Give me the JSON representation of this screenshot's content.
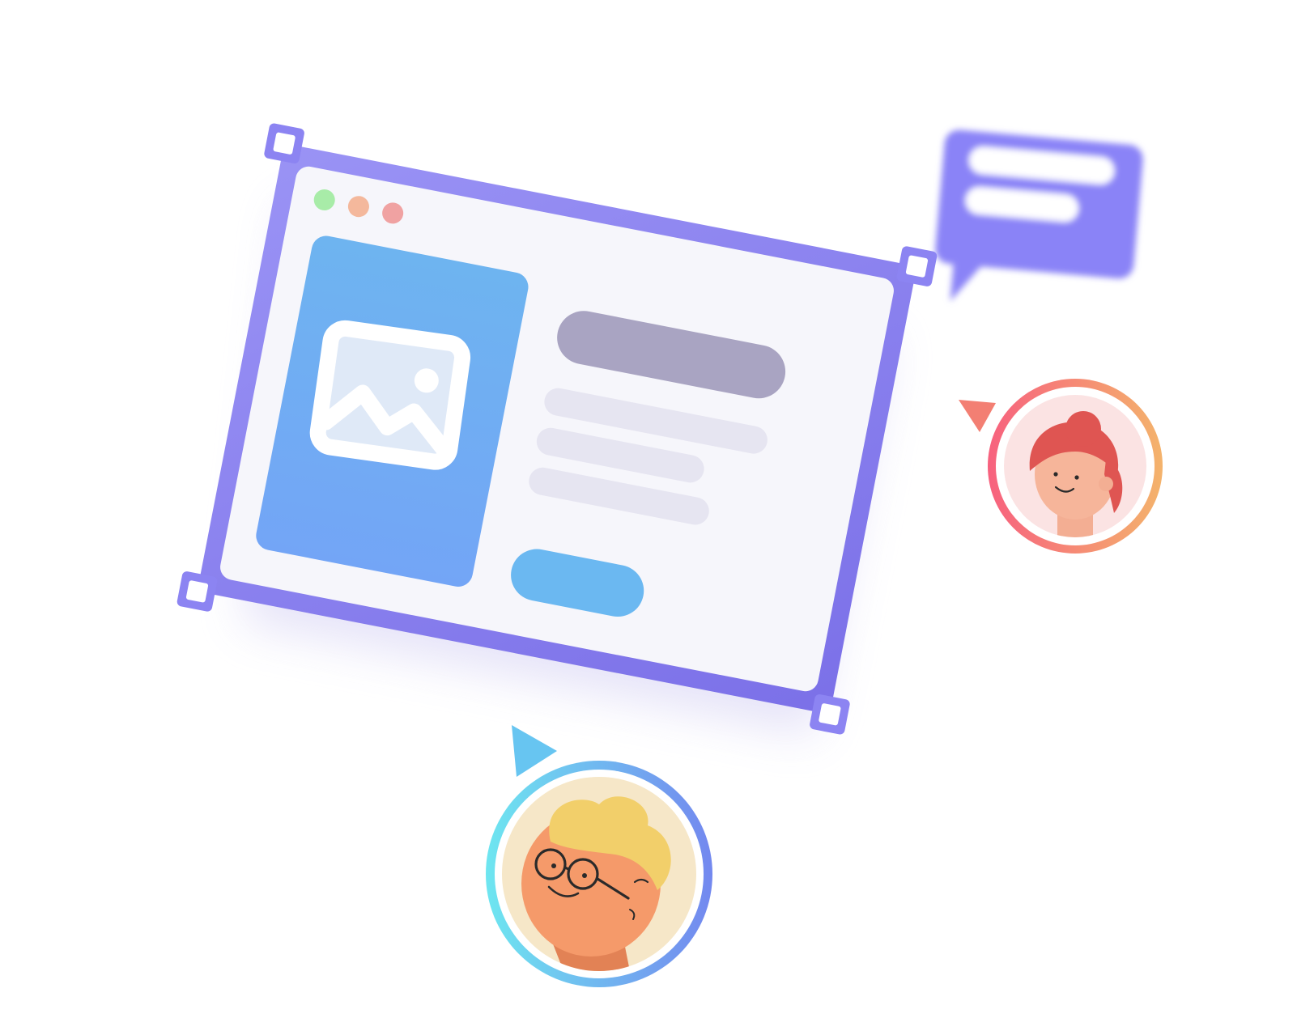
{
  "colors": {
    "frame_purple": "#8c84f2",
    "frame_purple_dark": "#776ce6",
    "window_bg": "#f6f6fb",
    "image_card_blue": "#6fb1f1",
    "title_bar": "#a9a4c2",
    "text_line": "#e6e5f1",
    "cta_button": "#6bb8f1",
    "dot_green": "#a8eca8",
    "dot_orange": "#f4b89c",
    "dot_red": "#f0a2a2",
    "chat_bubble": "#8a83f7",
    "avatar_woman_ring_start": "#f7617e",
    "avatar_woman_ring_end": "#f4b36c",
    "avatar_man_ring_start": "#6ee6f0",
    "avatar_man_ring_end": "#7388ef",
    "cursor_red": "#f37f73",
    "cursor_blue": "#67c5f1"
  },
  "icons": {
    "window_frame": "browser-window-icon",
    "image_placeholder": "image-icon",
    "chat": "chat-bubble-icon",
    "cursor_red": "cursor-pointer-icon",
    "cursor_blue": "cursor-pointer-icon",
    "avatar_woman": "avatar-woman-icon",
    "avatar_man": "avatar-man-icon",
    "resize_handle": "resize-handle-icon"
  },
  "window_controls": [
    "close",
    "minimize",
    "maximize"
  ]
}
